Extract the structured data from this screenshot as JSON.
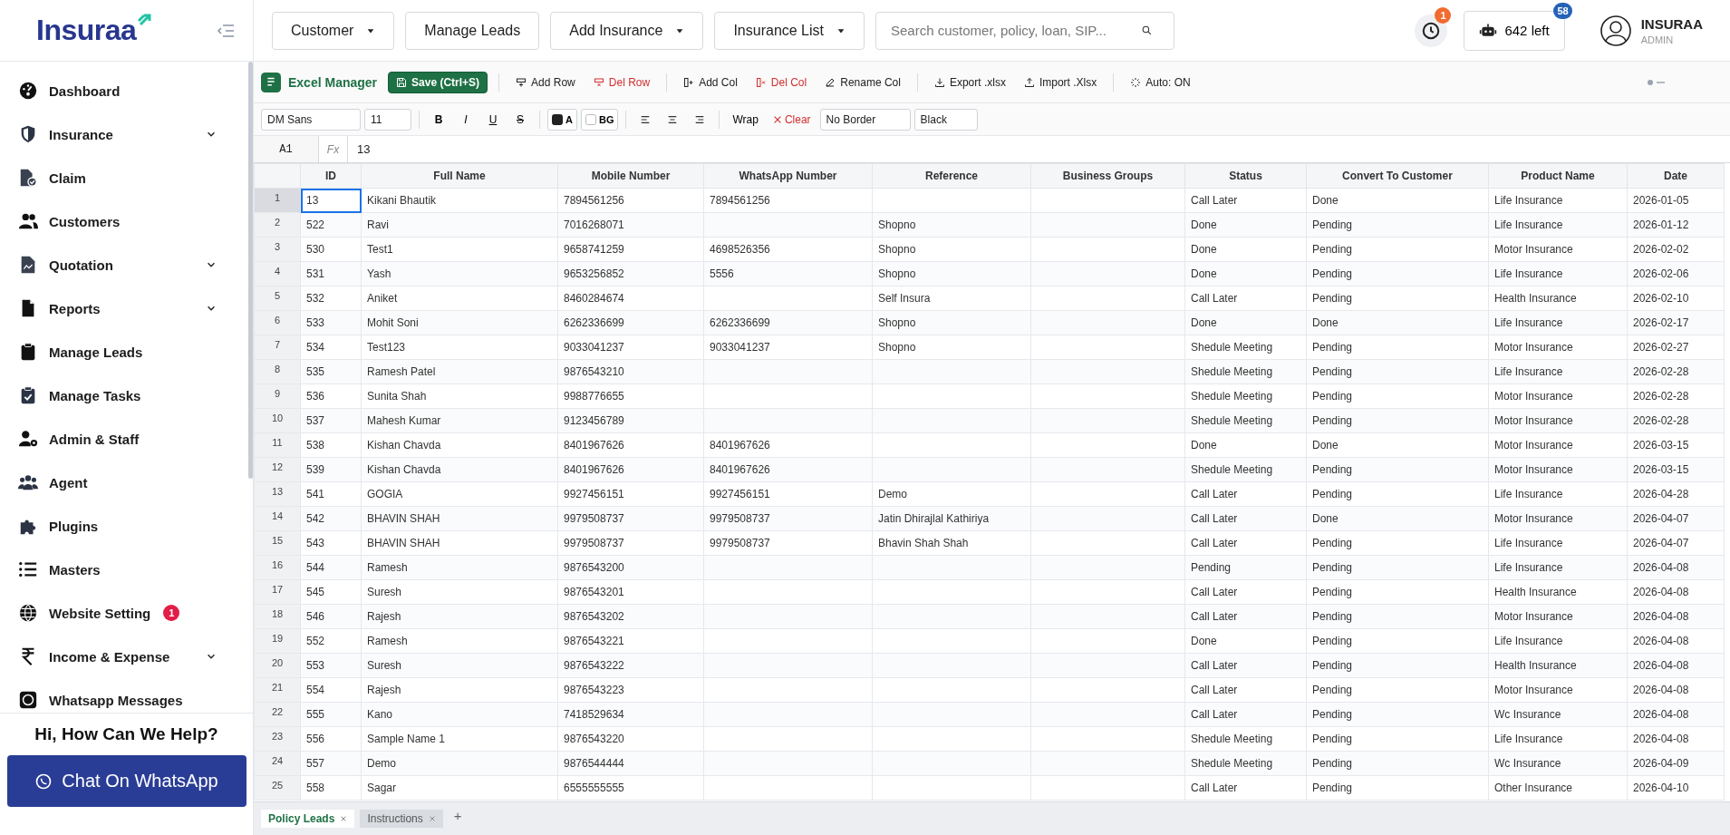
{
  "header": {
    "logo": "Insuraa",
    "nav": [
      {
        "label": "Customer",
        "dropdown": true
      },
      {
        "label": "Manage Leads",
        "dropdown": false
      },
      {
        "label": "Add Insurance",
        "dropdown": true
      },
      {
        "label": "Insurance List",
        "dropdown": true
      }
    ],
    "search": {
      "placeholder": "Search customer, policy, loan, SIP..."
    },
    "reminder_badge": "1",
    "credits": {
      "label": "642 left",
      "badge": "58"
    },
    "user": {
      "name": "INSURAA",
      "role": "ADMIN"
    }
  },
  "sidebar": {
    "items": [
      {
        "label": "Dashboard",
        "expandable": false
      },
      {
        "label": "Insurance",
        "expandable": true
      },
      {
        "label": "Claim",
        "expandable": false
      },
      {
        "label": "Customers",
        "expandable": false
      },
      {
        "label": "Quotation",
        "expandable": true
      },
      {
        "label": "Reports",
        "expandable": true
      },
      {
        "label": "Manage Leads",
        "expandable": false
      },
      {
        "label": "Manage Tasks",
        "expandable": false
      },
      {
        "label": "Admin & Staff",
        "expandable": false
      },
      {
        "label": "Agent",
        "expandable": false
      },
      {
        "label": "Plugins",
        "expandable": false
      },
      {
        "label": "Masters",
        "expandable": false
      },
      {
        "label": "Website Setting",
        "expandable": false,
        "badge": "1"
      },
      {
        "label": "Income & Expense",
        "expandable": true
      },
      {
        "label": "Whatsapp Messages",
        "expandable": false
      }
    ],
    "help": {
      "title": "Hi, How Can We Help?",
      "button": "Chat On WhatsApp"
    }
  },
  "toolbar": {
    "title": "Excel Manager",
    "items": [
      {
        "label": "Save (Ctrl+S)",
        "kind": "primary"
      },
      {
        "label": "Add Row",
        "kind": "normal"
      },
      {
        "label": "Del Row",
        "kind": "danger"
      },
      {
        "label": "Add Col",
        "kind": "normal"
      },
      {
        "label": "Del Col",
        "kind": "danger"
      },
      {
        "label": "Rename Col",
        "kind": "normal"
      },
      {
        "label": "Export .xlsx",
        "kind": "normal"
      },
      {
        "label": "Import .Xlsx",
        "kind": "normal"
      },
      {
        "label": "Auto: ON",
        "kind": "normal"
      }
    ]
  },
  "format_bar": {
    "font": "DM Sans",
    "size": "11",
    "styles": [
      "B",
      "I",
      "U",
      "S"
    ],
    "text_color": "A",
    "fill_color": "BG",
    "wrap": "Wrap",
    "clear": "Clear",
    "border": "No Border",
    "line_style": "Black"
  },
  "formula_bar": {
    "cell": "A1",
    "fx": "Fx",
    "value": "13"
  },
  "table": {
    "columns": [
      "ID",
      "Full Name",
      "Mobile Number",
      "WhatsApp Number",
      "Reference",
      "Business Groups",
      "Status",
      "Convert To Customer",
      "Product Name",
      "Date"
    ],
    "rows": [
      {
        "number": "1",
        "selected": true,
        "cells": [
          "13",
          "Kikani Bhautik",
          "7894561256",
          "7894561256",
          "",
          "",
          "Call Later",
          "Done",
          "Life Insurance",
          "2026-01-05"
        ]
      },
      {
        "number": "2",
        "selected": false,
        "cells": [
          "522",
          "Ravi",
          "7016268071",
          "",
          "Shopno",
          "",
          "Done",
          "Pending",
          "Life Insurance",
          "2026-01-12"
        ]
      },
      {
        "number": "3",
        "selected": false,
        "cells": [
          "530",
          "Test1",
          "9658741259",
          "4698526356",
          "Shopno",
          "",
          "Done",
          "Pending",
          "Motor Insurance",
          "2026-02-02"
        ]
      },
      {
        "number": "4",
        "selected": false,
        "cells": [
          "531",
          "Yash",
          "9653256852",
          "5556",
          "Shopno",
          "",
          "Done",
          "Pending",
          "Life Insurance",
          "2026-02-06"
        ]
      },
      {
        "number": "5",
        "selected": false,
        "cells": [
          "532",
          "Aniket",
          "8460284674",
          "",
          "Self Insura",
          "",
          "Call Later",
          "Pending",
          "Health Insurance",
          "2026-02-10"
        ]
      },
      {
        "number": "6",
        "selected": false,
        "cells": [
          "533",
          "Mohit Soni",
          "6262336699",
          "6262336699",
          "Shopno",
          "",
          "Done",
          "Done",
          "Life Insurance",
          "2026-02-17"
        ]
      },
      {
        "number": "7",
        "selected": false,
        "cells": [
          "534",
          "Test123",
          "9033041237",
          "9033041237",
          "Shopno",
          "",
          "Shedule Meeting",
          "Pending",
          "Motor Insurance",
          "2026-02-27"
        ]
      },
      {
        "number": "8",
        "selected": false,
        "cells": [
          "535",
          "Ramesh Patel",
          "9876543210",
          "",
          "",
          "",
          "Shedule Meeting",
          "Pending",
          "Life Insurance",
          "2026-02-28"
        ]
      },
      {
        "number": "9",
        "selected": false,
        "cells": [
          "536",
          "Sunita Shah",
          "9988776655",
          "",
          "",
          "",
          "Shedule Meeting",
          "Pending",
          "Motor Insurance",
          "2026-02-28"
        ]
      },
      {
        "number": "10",
        "selected": false,
        "cells": [
          "537",
          "Mahesh Kumar",
          "9123456789",
          "",
          "",
          "",
          "Shedule Meeting",
          "Pending",
          "Motor Insurance",
          "2026-02-28"
        ]
      },
      {
        "number": "11",
        "selected": false,
        "cells": [
          "538",
          "Kishan Chavda",
          "8401967626",
          "8401967626",
          "",
          "",
          "Done",
          "Done",
          "Motor Insurance",
          "2026-03-15"
        ]
      },
      {
        "number": "12",
        "selected": false,
        "cells": [
          "539",
          "Kishan Chavda",
          "8401967626",
          "8401967626",
          "",
          "",
          "Shedule Meeting",
          "Pending",
          "Motor Insurance",
          "2026-03-15"
        ]
      },
      {
        "number": "13",
        "selected": false,
        "cells": [
          "541",
          "GOGIA",
          "9927456151",
          "9927456151",
          "Demo",
          "",
          "Call Later",
          "Pending",
          "Life Insurance",
          "2026-04-28"
        ]
      },
      {
        "number": "14",
        "selected": false,
        "cells": [
          "542",
          "BHAVIN SHAH",
          "9979508737",
          "9979508737",
          "Jatin Dhirajlal Kathiriya",
          "",
          "Call Later",
          "Done",
          "Motor Insurance",
          "2026-04-07"
        ]
      },
      {
        "number": "15",
        "selected": false,
        "cells": [
          "543",
          "BHAVIN SHAH",
          "9979508737",
          "9979508737",
          "Bhavin Shah Shah",
          "",
          "Call Later",
          "Pending",
          "Life Insurance",
          "2026-04-07"
        ]
      },
      {
        "number": "16",
        "selected": false,
        "cells": [
          "544",
          "Ramesh",
          "9876543200",
          "",
          "",
          "",
          "Pending",
          "Pending",
          "Life Insurance",
          "2026-04-08"
        ]
      },
      {
        "number": "17",
        "selected": false,
        "cells": [
          "545",
          "Suresh",
          "9876543201",
          "",
          "",
          "",
          "Call Later",
          "Pending",
          "Health Insurance",
          "2026-04-08"
        ]
      },
      {
        "number": "18",
        "selected": false,
        "cells": [
          "546",
          "Rajesh",
          "9876543202",
          "",
          "",
          "",
          "Call Later",
          "Pending",
          "Motor Insurance",
          "2026-04-08"
        ]
      },
      {
        "number": "19",
        "selected": false,
        "cells": [
          "552",
          "Ramesh",
          "9876543221",
          "",
          "",
          "",
          "Done",
          "Pending",
          "Life Insurance",
          "2026-04-08"
        ]
      },
      {
        "number": "20",
        "selected": false,
        "cells": [
          "553",
          "Suresh",
          "9876543222",
          "",
          "",
          "",
          "Call Later",
          "Pending",
          "Health Insurance",
          "2026-04-08"
        ]
      },
      {
        "number": "21",
        "selected": false,
        "cells": [
          "554",
          "Rajesh",
          "9876543223",
          "",
          "",
          "",
          "Call Later",
          "Pending",
          "Motor Insurance",
          "2026-04-08"
        ]
      },
      {
        "number": "22",
        "selected": false,
        "cells": [
          "555",
          "Kano",
          "7418529634",
          "",
          "",
          "",
          "Call Later",
          "Pending",
          "Wc Insurance",
          "2026-04-08"
        ]
      },
      {
        "number": "23",
        "selected": false,
        "cells": [
          "556",
          "Sample Name 1",
          "9876543220",
          "",
          "",
          "",
          "Shedule Meeting",
          "Pending",
          "Life Insurance",
          "2026-04-08"
        ]
      },
      {
        "number": "24",
        "selected": false,
        "cells": [
          "557",
          "Demo",
          "9876544444",
          "",
          "",
          "",
          "Shedule Meeting",
          "Pending",
          "Wc Insurance",
          "2026-04-09"
        ]
      },
      {
        "number": "25",
        "selected": false,
        "cells": [
          "558",
          "Sagar",
          "6555555555",
          "",
          "",
          "",
          "Call Later",
          "Pending",
          "Other Insurance",
          "2026-04-10"
        ]
      }
    ]
  },
  "sheets": {
    "tabs": [
      {
        "label": "Policy Leads",
        "selected": true
      },
      {
        "label": "Instructions",
        "selected": false
      }
    ],
    "add": "+"
  }
}
